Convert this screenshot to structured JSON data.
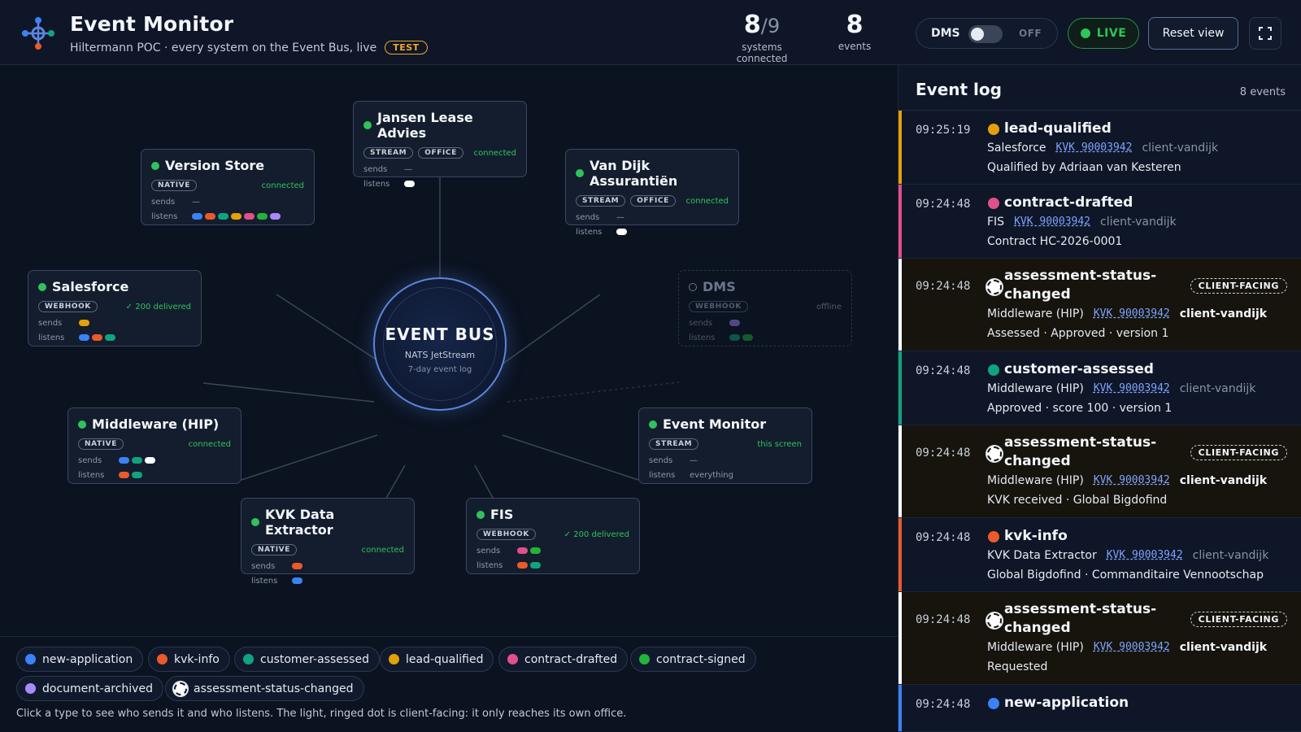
{
  "header": {
    "title": "Event Monitor",
    "subtitle": "Hiltermann POC · every system on the Event Bus, live",
    "env_badge": "TEST",
    "systems_connected": "8",
    "systems_total": "/9",
    "systems_label": "systems connected",
    "events_count": "8",
    "events_label": "events",
    "dms_label": "DMS",
    "dms_state": "OFF",
    "live_label": "LIVE",
    "reset_label": "Reset view"
  },
  "colors": {
    "new-application": "#3b82f6",
    "kvk-info": "#ea5a2a",
    "customer-assessed": "#10a37f",
    "lead-qualified": "#e3a008",
    "contract-drafted": "#e0508a",
    "contract-signed": "#22b33a",
    "document-archived": "#a78bfa",
    "assessment-status-changed": "#ffffff"
  },
  "bus": {
    "title": "EVENT BUS",
    "subtitle": "NATS JetStream",
    "retention": "7-day event log"
  },
  "io_labels": {
    "sends": "sends",
    "listens": "listens",
    "none": "—"
  },
  "nodes": {
    "jansen": {
      "name": "Jansen Lease Advies",
      "tags": [
        "STREAM",
        "OFFICE"
      ],
      "status": "connected",
      "sends": [],
      "listens": [
        "assessment-status-changed"
      ]
    },
    "version": {
      "name": "Version Store",
      "tags": [
        "NATIVE"
      ],
      "status": "connected",
      "sends": [],
      "listens": [
        "new-application",
        "kvk-info",
        "customer-assessed",
        "lead-qualified",
        "contract-drafted",
        "contract-signed",
        "document-archived"
      ]
    },
    "vandijk": {
      "name": "Van Dijk Assurantiën",
      "tags": [
        "STREAM",
        "OFFICE"
      ],
      "status": "connected",
      "sends": [],
      "listens": [
        "assessment-status-changed"
      ]
    },
    "salesforce": {
      "name": "Salesforce",
      "tags": [
        "WEBHOOK"
      ],
      "status": "✓ 200 delivered",
      "sends": [
        "lead-qualified"
      ],
      "listens": [
        "new-application",
        "kvk-info",
        "customer-assessed"
      ]
    },
    "dms": {
      "name": "DMS",
      "tags": [
        "WEBHOOK"
      ],
      "status": "offline",
      "sends": [
        "document-archived"
      ],
      "listens": [
        "customer-assessed",
        "contract-signed"
      ]
    },
    "middleware": {
      "name": "Middleware (HIP)",
      "tags": [
        "NATIVE"
      ],
      "status": "connected",
      "sends": [
        "new-application",
        "customer-assessed",
        "assessment-status-changed"
      ],
      "listens": [
        "kvk-info",
        "customer-assessed"
      ]
    },
    "monitor": {
      "name": "Event Monitor",
      "tags": [
        "STREAM"
      ],
      "status": "this screen",
      "sends_text": "—",
      "listens_text": "everything"
    },
    "kvk": {
      "name": "KVK Data Extractor",
      "tags": [
        "NATIVE"
      ],
      "status": "connected",
      "sends": [
        "kvk-info"
      ],
      "listens": [
        "new-application"
      ]
    },
    "fis": {
      "name": "FIS",
      "tags": [
        "WEBHOOK"
      ],
      "status": "✓ 200 delivered",
      "sends": [
        "contract-drafted",
        "contract-signed"
      ],
      "listens": [
        "kvk-info",
        "customer-assessed"
      ]
    }
  },
  "legend": {
    "items": [
      "new-application",
      "kvk-info",
      "customer-assessed",
      "lead-qualified",
      "contract-drafted",
      "contract-signed",
      "document-archived",
      "assessment-status-changed"
    ],
    "help": "Click a type to see who sends it and who listens. The light, ringed dot is client-facing: it only reaches its own office."
  },
  "log": {
    "title": "Event log",
    "count": "8 events",
    "cf_label": "CLIENT-FACING",
    "entries": [
      {
        "time": "09:25:19",
        "type": "lead-qualified",
        "name": "lead-qualified",
        "source": "Salesforce",
        "kvk": "KVK 90003942",
        "client": "client-vandijk",
        "detail": "Qualified by Adriaan van Kesteren"
      },
      {
        "time": "09:24:48",
        "type": "contract-drafted",
        "name": "contract-drafted",
        "source": "FIS",
        "kvk": "KVK 90003942",
        "client": "client-vandijk",
        "detail": "Contract HC-2026-0001"
      },
      {
        "time": "09:24:48",
        "type": "assessment-status-changed",
        "name_l1": "assessment-status-",
        "name_l2": "changed",
        "source": "Middleware (HIP)",
        "kvk": "KVK 90003942",
        "client": "client-vandijk",
        "detail": "Assessed · Approved · version 1"
      },
      {
        "time": "09:24:48",
        "type": "customer-assessed",
        "name": "customer-assessed",
        "source": "Middleware (HIP)",
        "kvk": "KVK 90003942",
        "client": "client-vandijk",
        "detail": "Approved · score 100 · version 1"
      },
      {
        "time": "09:24:48",
        "type": "assessment-status-changed",
        "name_l1": "assessment-status-",
        "name_l2": "changed",
        "source": "Middleware (HIP)",
        "kvk": "KVK 90003942",
        "client": "client-vandijk",
        "detail": "KVK received · Global Bigdofind"
      },
      {
        "time": "09:24:48",
        "type": "kvk-info",
        "name": "kvk-info",
        "source": "KVK Data Extractor",
        "kvk": "KVK 90003942",
        "client": "client-vandijk",
        "detail": "Global Bigdofind · Commanditaire Vennootschap"
      },
      {
        "time": "09:24:48",
        "type": "assessment-status-changed",
        "name_l1": "assessment-status-",
        "name_l2": "changed",
        "source": "Middleware (HIP)",
        "kvk": "KVK 90003942",
        "client": "client-vandijk",
        "detail": "Requested"
      },
      {
        "time": "09:24:48",
        "type": "new-application",
        "name": "new-application"
      }
    ]
  }
}
